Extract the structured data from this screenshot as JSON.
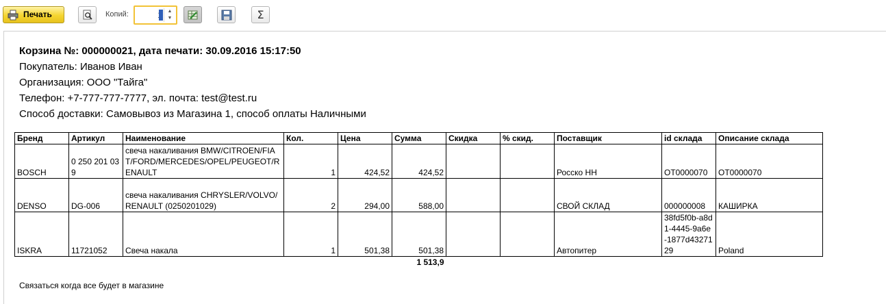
{
  "toolbar": {
    "print_label": "Печать",
    "copies_label": "Копий:",
    "copies_value": "1",
    "icons": [
      "printer-icon",
      "preview-icon",
      "edit-icon",
      "save-icon",
      "sum-icon"
    ]
  },
  "document": {
    "title": "Корзина №: 000000021, дата печати: 30.09.2016 15:17:50",
    "buyer": "Покупатель: Иванов Иван",
    "organization": "Организация: ООО \"Тайга\"",
    "contacts": "Телефон: +7-777-777-7777, эл. почта: test@test.ru",
    "delivery": "Способ доставки: Самовывоз из Магазина 1, способ оплаты Наличными",
    "columns": [
      "Бренд",
      "Артикул",
      "Наименование",
      "Кол.",
      "Цена",
      "Сумма",
      "Скидка",
      "% скид.",
      "Поставщик",
      "id склада",
      "Описание склада"
    ],
    "rows": [
      {
        "brand": "BOSCH",
        "article": "0 250 201 039",
        "name": "свеча накаливания BMW/CITROEN/FIAT/FORD/MERCEDES/OPEL/PEUGEOT/RENAULT",
        "qty": "1",
        "price": "424,52",
        "sum": "424,52",
        "discount": "",
        "discount_pct": "",
        "supplier": "Росско НН",
        "warehouse_id": "ОТ0000070",
        "warehouse_desc": "ОТ0000070"
      },
      {
        "brand": "DENSO",
        "article": "DG-006",
        "name": "свеча накаливания CHRYSLER/VOLVO/RENAULT (0250201029)",
        "qty": "2",
        "price": "294,00",
        "sum": "588,00",
        "discount": "",
        "discount_pct": "",
        "supplier": "СВОЙ СКЛАД",
        "warehouse_id": "000000008",
        "warehouse_desc": "КАШИРКА"
      },
      {
        "brand": "ISKRA",
        "article": "11721052",
        "name": "Свеча накала",
        "qty": "1",
        "price": "501,38",
        "sum": "501,38",
        "discount": "",
        "discount_pct": "",
        "supplier": "Автопитер",
        "warehouse_id": "38fd5f0b-a8d1-4445-9a6e-1877d4327129",
        "warehouse_desc": "Poland"
      }
    ],
    "total": "1 513,9",
    "note": "Связаться когда все будет в магазине"
  },
  "colors": {
    "accent_yellow": "#f5d530",
    "focus_border": "#f2c236",
    "caret_blue": "#2f5fb8"
  }
}
